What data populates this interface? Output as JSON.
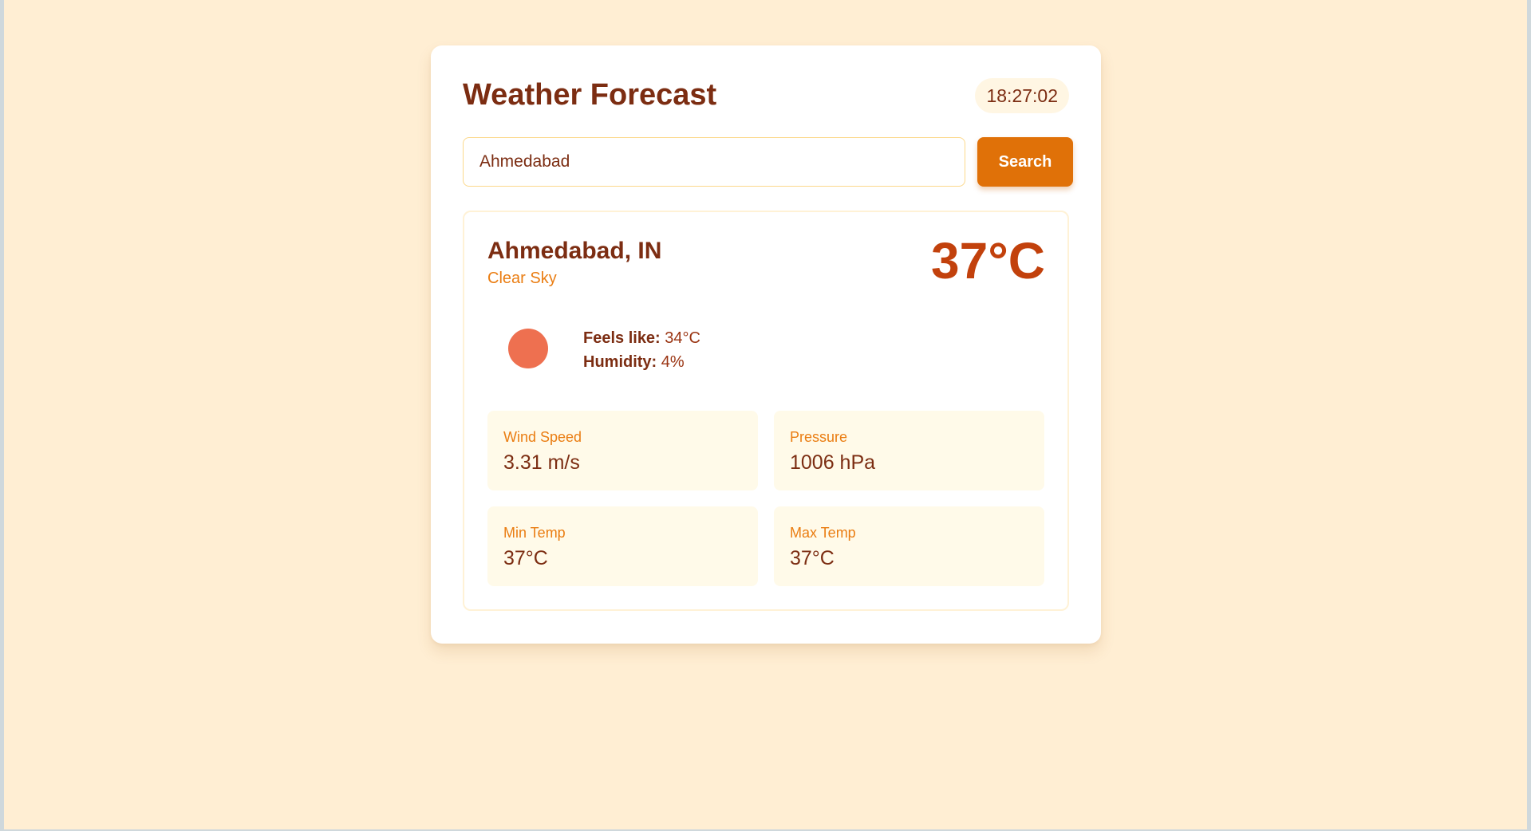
{
  "app": {
    "title": "Weather Forecast",
    "time": "18:27:02"
  },
  "search": {
    "value": "Ahmedabad",
    "button_label": "Search"
  },
  "weather": {
    "location": "Ahmedabad, IN",
    "condition": "Clear Sky",
    "temperature": "37°C",
    "icon": "sun-icon",
    "icon_color": "#ee7050",
    "feels_like_label": "Feels like:",
    "feels_like_value": "34°C",
    "humidity_label": "Humidity:",
    "humidity_value": "4%"
  },
  "stats": [
    {
      "label": "Wind Speed",
      "value": "3.31 m/s"
    },
    {
      "label": "Pressure",
      "value": "1006 hPa"
    },
    {
      "label": "Min Temp",
      "value": "37°C"
    },
    {
      "label": "Max Temp",
      "value": "37°C"
    }
  ],
  "colors": {
    "background": "#ffeed3",
    "accent": "#e07108",
    "heading": "#7c2d12",
    "temperature": "#c2410c"
  }
}
